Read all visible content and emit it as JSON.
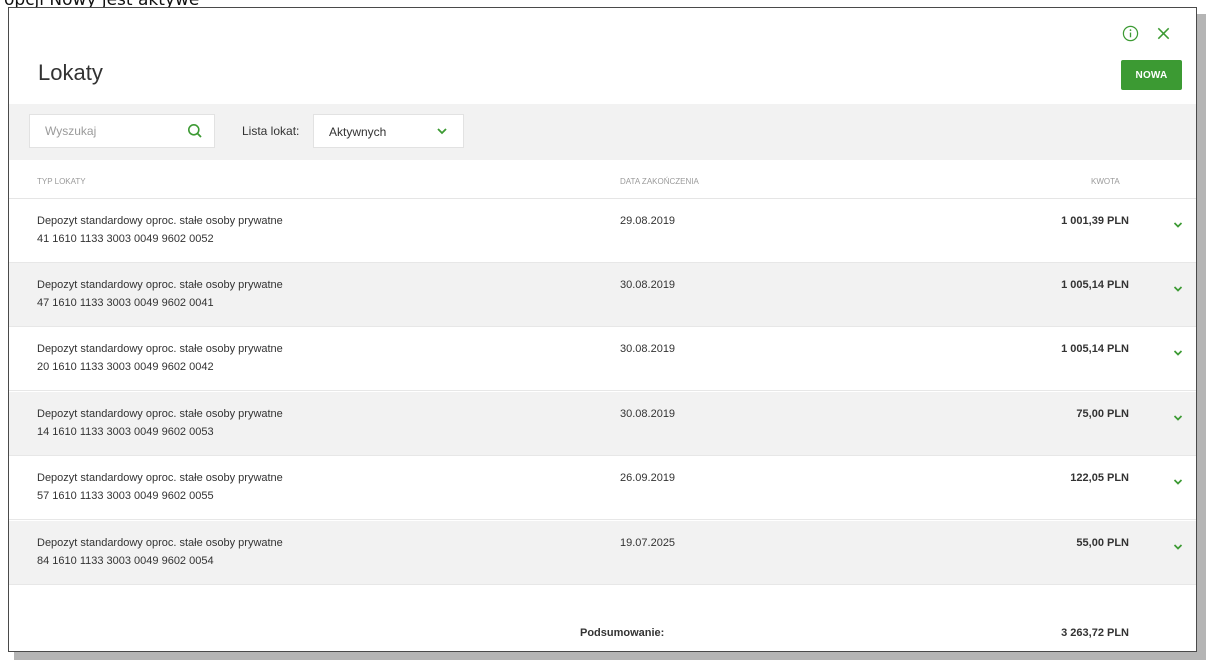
{
  "top_cropped_text": "opcji Nowy jest aktywe",
  "colors": {
    "accent": "#3c9a33",
    "row_shade": "#f2f2f2",
    "text": "#333333",
    "muted": "#9a9a9a"
  },
  "header": {
    "title": "Lokaty",
    "new_button_label": "NOWA",
    "info_icon": "info-icon",
    "close_icon": "close-icon"
  },
  "filters": {
    "search_placeholder": "Wyszukaj",
    "search_value": "",
    "list_label": "Lista lokat:",
    "list_selected": "Aktywnych"
  },
  "table": {
    "columns": [
      "TYP LOKATY",
      "DATA ZAKOŃCZENIA",
      "KWOTA"
    ],
    "rows": [
      {
        "type": "Depozyt standardowy oproc. stałe osoby prywatne",
        "account": "41 1610 1133 3003 0049 9602 0052",
        "end_date": "29.08.2019",
        "amount": "1 001,39 PLN"
      },
      {
        "type": "Depozyt standardowy oproc. stałe osoby prywatne",
        "account": "47 1610 1133 3003 0049 9602 0041",
        "end_date": "30.08.2019",
        "amount": "1 005,14 PLN"
      },
      {
        "type": "Depozyt standardowy oproc. stałe osoby prywatne",
        "account": "20 1610 1133 3003 0049 9602 0042",
        "end_date": "30.08.2019",
        "amount": "1 005,14 PLN"
      },
      {
        "type": "Depozyt standardowy oproc. stałe osoby prywatne",
        "account": "14 1610 1133 3003 0049 9602 0053",
        "end_date": "30.08.2019",
        "amount": "75,00 PLN"
      },
      {
        "type": "Depozyt standardowy oproc. stałe osoby prywatne",
        "account": "57 1610 1133 3003 0049 9602 0055",
        "end_date": "26.09.2019",
        "amount": "122,05 PLN"
      },
      {
        "type": "Depozyt standardowy oproc. stałe osoby prywatne",
        "account": "84 1610 1133 3003 0049 9602 0054",
        "end_date": "19.07.2025",
        "amount": "55,00 PLN"
      }
    ]
  },
  "summary": {
    "label": "Podsumowanie:",
    "value": "3 263,72 PLN"
  }
}
